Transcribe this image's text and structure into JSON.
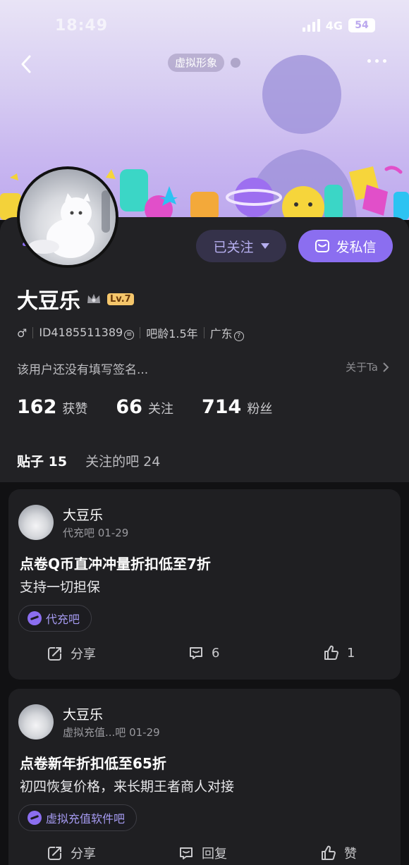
{
  "status_bar": {
    "time": "18:49",
    "network": "4G",
    "battery": "54"
  },
  "header": {
    "virtual_avatar_label": "虚拟形象"
  },
  "profile": {
    "username": "大豆乐",
    "level": "Lv.7",
    "follow_button": "已关注",
    "message_button": "发私信",
    "gender_symbol": "♂",
    "id_text": "ID4185511389",
    "forum_age": "吧龄1.5年",
    "location": "广东",
    "bio": "该用户还没有填写签名...",
    "about_link": "关于Ta",
    "stats": [
      {
        "num": "162",
        "label": "获赞"
      },
      {
        "num": "66",
        "label": "关注"
      },
      {
        "num": "714",
        "label": "粉丝"
      }
    ],
    "tabs": [
      {
        "label": "贴子",
        "count": "15"
      },
      {
        "label": "关注的吧",
        "count": "24"
      }
    ]
  },
  "posts": [
    {
      "author": "大豆乐",
      "meta": "代充吧   01-29",
      "title": "点卷Q币直冲冲量折扣低至7折",
      "body": "支持一切担保",
      "tag": "代充吧",
      "share_label": "分享",
      "comment_label": "6",
      "like_label": "1"
    },
    {
      "author": "大豆乐",
      "meta": "虚拟充值...吧   01-29",
      "title": "点卷新年折扣低至65折",
      "body": "初四恢复价格，来长期王者商人对接",
      "tag": "虚拟充值软件吧",
      "share_label": "分享",
      "comment_label": "回复",
      "like_label": "赞"
    }
  ],
  "colors": {
    "accent": "#8b6ef0",
    "background": "#111113",
    "card": "#1f1f22"
  }
}
